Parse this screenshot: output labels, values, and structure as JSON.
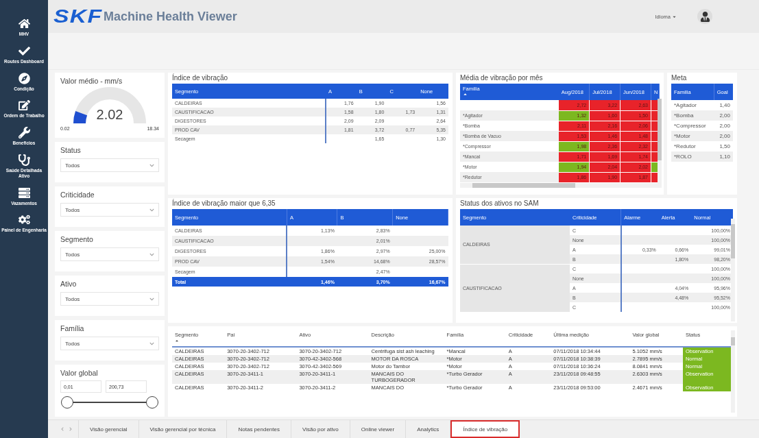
{
  "sidebar": {
    "items": [
      {
        "label": "MHV"
      },
      {
        "label": "Routes Dashboard"
      },
      {
        "label": "Condição"
      },
      {
        "label": "Ordem de Trabalho"
      },
      {
        "label": "Benefícios"
      },
      {
        "label": "Saúde Detalhada Ativo"
      },
      {
        "label": "Vazamentos"
      },
      {
        "label": "Painel de Engenharia"
      }
    ]
  },
  "header": {
    "logo": "SKF",
    "title": "Machine Health Viewer",
    "language_menu": "Idioma"
  },
  "gauge": {
    "title": "Valor médio - mm/s",
    "value": "2.02",
    "min": "0.02",
    "max": "18.34",
    "level": 0.11
  },
  "filters": [
    {
      "label": "Status",
      "value": "Todos"
    },
    {
      "label": "Criticidade",
      "value": "Todos"
    },
    {
      "label": "Segmento",
      "value": "Todos"
    },
    {
      "label": "Ativo",
      "value": "Todos"
    },
    {
      "label": "Família",
      "value": "Todos"
    }
  ],
  "range_filter": {
    "label": "Valor global",
    "min": "0,01",
    "max": "200,73",
    "thumbs": [
      {
        "level": 0
      },
      {
        "level": 1
      }
    ]
  },
  "vibration_index": {
    "title": "Índice de vibração",
    "columns": [
      "Segmento",
      "A",
      "B",
      "C",
      "None"
    ],
    "rows": [
      [
        "CALDEIRAS",
        "1,76",
        "1,90",
        null,
        "1,56"
      ],
      [
        "CAUSTIFICACAO",
        "1,58",
        "1,80",
        "1,73",
        "1,31"
      ],
      [
        "DIGESTORES",
        "2,09",
        "2,09",
        null,
        "2,64"
      ],
      [
        "PROD CAV",
        "1,81",
        "3,72",
        "0,77",
        "5,35"
      ],
      [
        "Secagem",
        null,
        "1,65",
        null,
        "1,30"
      ]
    ]
  },
  "monthly_average": {
    "title": "Média de vibração por mês",
    "columns": [
      "Família",
      "Aug/2018",
      "Jul/2018",
      "Jun/2018",
      "N"
    ],
    "rows": [
      {
        "cells": [
          {},
          {
            "value": "2,72",
            "color": "#e8232a"
          },
          {
            "value": "3,22",
            "color": "#e8232a"
          },
          {
            "value": "2,63",
            "color": "#e8232a"
          },
          {
            "color": "#e8232a"
          }
        ]
      },
      {
        "cells": [
          {
            "value": "*Agitador"
          },
          {
            "value": "1,32",
            "color": "#7cb820"
          },
          {
            "value": "1,60",
            "color": "#e8232a"
          },
          {
            "value": "1,50",
            "color": "#e8232a"
          },
          {
            "color": "#e8232a"
          }
        ]
      },
      {
        "cells": [
          {
            "value": "*Bomba"
          },
          {
            "value": "2,11",
            "color": "#e8232a"
          },
          {
            "value": "2,16",
            "color": "#e8232a"
          },
          {
            "value": "2,06",
            "color": "#e8232a"
          },
          {
            "color": "#e8232a"
          }
        ]
      },
      {
        "cells": [
          {
            "value": "*Bomba de Vacuo"
          },
          {
            "value": "1,53",
            "color": "#e8232a"
          },
          {
            "value": "1,46",
            "color": "#e8232a"
          },
          {
            "value": "1,48",
            "color": "#e8232a"
          },
          {
            "color": "#e8232a"
          }
        ]
      },
      {
        "cells": [
          {
            "value": "*Compressor"
          },
          {
            "value": "1,98",
            "color": "#7cb820"
          },
          {
            "value": "2,36",
            "color": "#e8232a"
          },
          {
            "value": "2,32",
            "color": "#e8232a"
          },
          {
            "color": "#e8232a"
          }
        ]
      },
      {
        "cells": [
          {
            "value": "*Mancal"
          },
          {
            "value": "1,71",
            "color": "#e8232a"
          },
          {
            "value": "1,69",
            "color": "#e8232a"
          },
          {
            "value": "1,74",
            "color": "#e8232a"
          },
          {
            "color": "#e8232a"
          }
        ]
      },
      {
        "cells": [
          {
            "value": "*Motor"
          },
          {
            "value": "1,94",
            "color": "#7cb820"
          },
          {
            "value": "2,04",
            "color": "#e8232a"
          },
          {
            "value": "2,02",
            "color": "#e8232a"
          },
          {
            "color": "#7cb820"
          }
        ]
      },
      {
        "cells": [
          {
            "value": "*Redutor"
          },
          {
            "value": "1,86",
            "color": "#e8232a"
          },
          {
            "value": "1,90",
            "color": "#e8232a"
          },
          {
            "value": "1,87",
            "color": "#e8232a"
          },
          {
            "color": "#e8232a"
          }
        ]
      }
    ]
  },
  "goal": {
    "title": "Meta",
    "columns": [
      "Família",
      "Goal"
    ],
    "rows": [
      [
        "*Agitador",
        "1,40"
      ],
      [
        "*Bomba",
        "2,00"
      ],
      [
        "*Compressor",
        "2,00"
      ],
      [
        "*Motor",
        "2,00"
      ],
      [
        "*Redutor",
        "1,50"
      ],
      [
        "*ROLO",
        "1,10"
      ]
    ]
  },
  "vibration_above": {
    "title": "Índice de vibração maior que 6,35",
    "columns": [
      "Segmento",
      "A",
      "B",
      "None"
    ],
    "rows": [
      [
        "CALDEIRAS",
        "1,13%",
        "2,83%",
        null
      ],
      [
        "CAUSTIFICACAO",
        null,
        "2,01%",
        null
      ],
      [
        "DIGESTORES",
        "1,86%",
        "2,97%",
        "25,00%"
      ],
      [
        "PROD CAV",
        "1,54%",
        "14,68%",
        "28,57%"
      ],
      [
        "Secagem",
        null,
        "2,47%",
        null
      ]
    ],
    "total": [
      "Total",
      "1,46%",
      "3,70%",
      "16,67%"
    ]
  },
  "sam_status": {
    "title": "Status dos ativos no SAM",
    "columns": [
      "Segmento",
      "Criticidade",
      "Alarme",
      "Alerta",
      "Normal"
    ],
    "groups": [
      {
        "segment": "CALDEIRAS",
        "rows": [
          [
            "C",
            null,
            null,
            "100,00%"
          ],
          [
            "None",
            null,
            null,
            "100,00%"
          ],
          [
            "A",
            "0,33%",
            "0,66%",
            "99,01%"
          ],
          [
            "B",
            null,
            "1,80%",
            "98,20%"
          ]
        ]
      },
      {
        "segment": "CAUSTIFICACAO",
        "rows": [
          [
            "C",
            null,
            null,
            "100,00%"
          ],
          [
            "None",
            null,
            null,
            "100,00%"
          ],
          [
            "A",
            null,
            "4,04%",
            "95,96%"
          ],
          [
            "B",
            null,
            "4,48%",
            "95,52%"
          ],
          [
            "C",
            null,
            null,
            "100,00%"
          ]
        ]
      }
    ]
  },
  "assets": {
    "columns": [
      "Segmento",
      "Pai",
      "Ativo",
      "Descrição",
      "Família",
      "Criticidade",
      "Última medição",
      "Valor global",
      "Status"
    ],
    "rows": [
      {
        "cells": [
          "CALDEIRAS",
          "3070-20-3402-712",
          "3070-20-3402-712",
          "Centrifuga sist ash leaching",
          "*Mancal",
          "A",
          "07/11/2018 10:34:44",
          "5.1052 mm/s"
        ],
        "status": "Observation",
        "color": "#7cb820"
      },
      {
        "cells": [
          "CALDEIRAS",
          "3070-20-3402-712",
          "3070-42-3402-568",
          "MOTOR DA ROSCA",
          "*Motor",
          "A",
          "07/11/2018 10:38:39",
          "2.7895 mm/s"
        ],
        "status": "Normal",
        "color": "#7cb820"
      },
      {
        "cells": [
          "CALDEIRAS",
          "3070-20-3402-712",
          "3070-42-3402-569",
          "Motor do Tambor",
          "*Motor",
          "A",
          "07/11/2018 10:36:24",
          "8.0841 mm/s"
        ],
        "status": "Normal",
        "color": "#7cb820"
      },
      {
        "cells": [
          "CALDEIRAS",
          "3070-20-3411-1",
          "3070-20-3411-1",
          "MANCAIS DO TURBOGERADOR",
          "*Turbo Gerador",
          "A",
          "23/11/2018 09:48:55",
          "2.6303 mm/s"
        ],
        "status": "Observation",
        "color": "#7cb820"
      },
      {
        "cells": [
          "CALDEIRAS",
          "3070-20-3411-2",
          "3070-20-3411-2",
          "MANCAIS DO",
          "*Turbo Gerador",
          "A",
          "23/11/2018 09:53:00",
          "2.4671 mm/s"
        ],
        "status": "Observation",
        "color": "#7cb820"
      }
    ]
  },
  "tabs": [
    {
      "label": "Visão gerencial",
      "selected": false
    },
    {
      "label": "Visão gerencial por técnica",
      "selected": false
    },
    {
      "label": "Notas pendentes",
      "selected": false
    },
    {
      "label": "Visão por ativo",
      "selected": false
    },
    {
      "label": "Online viewer",
      "selected": false
    },
    {
      "label": "Analytics",
      "selected": false
    },
    {
      "label": "Índice de vibração",
      "selected": true
    }
  ]
}
